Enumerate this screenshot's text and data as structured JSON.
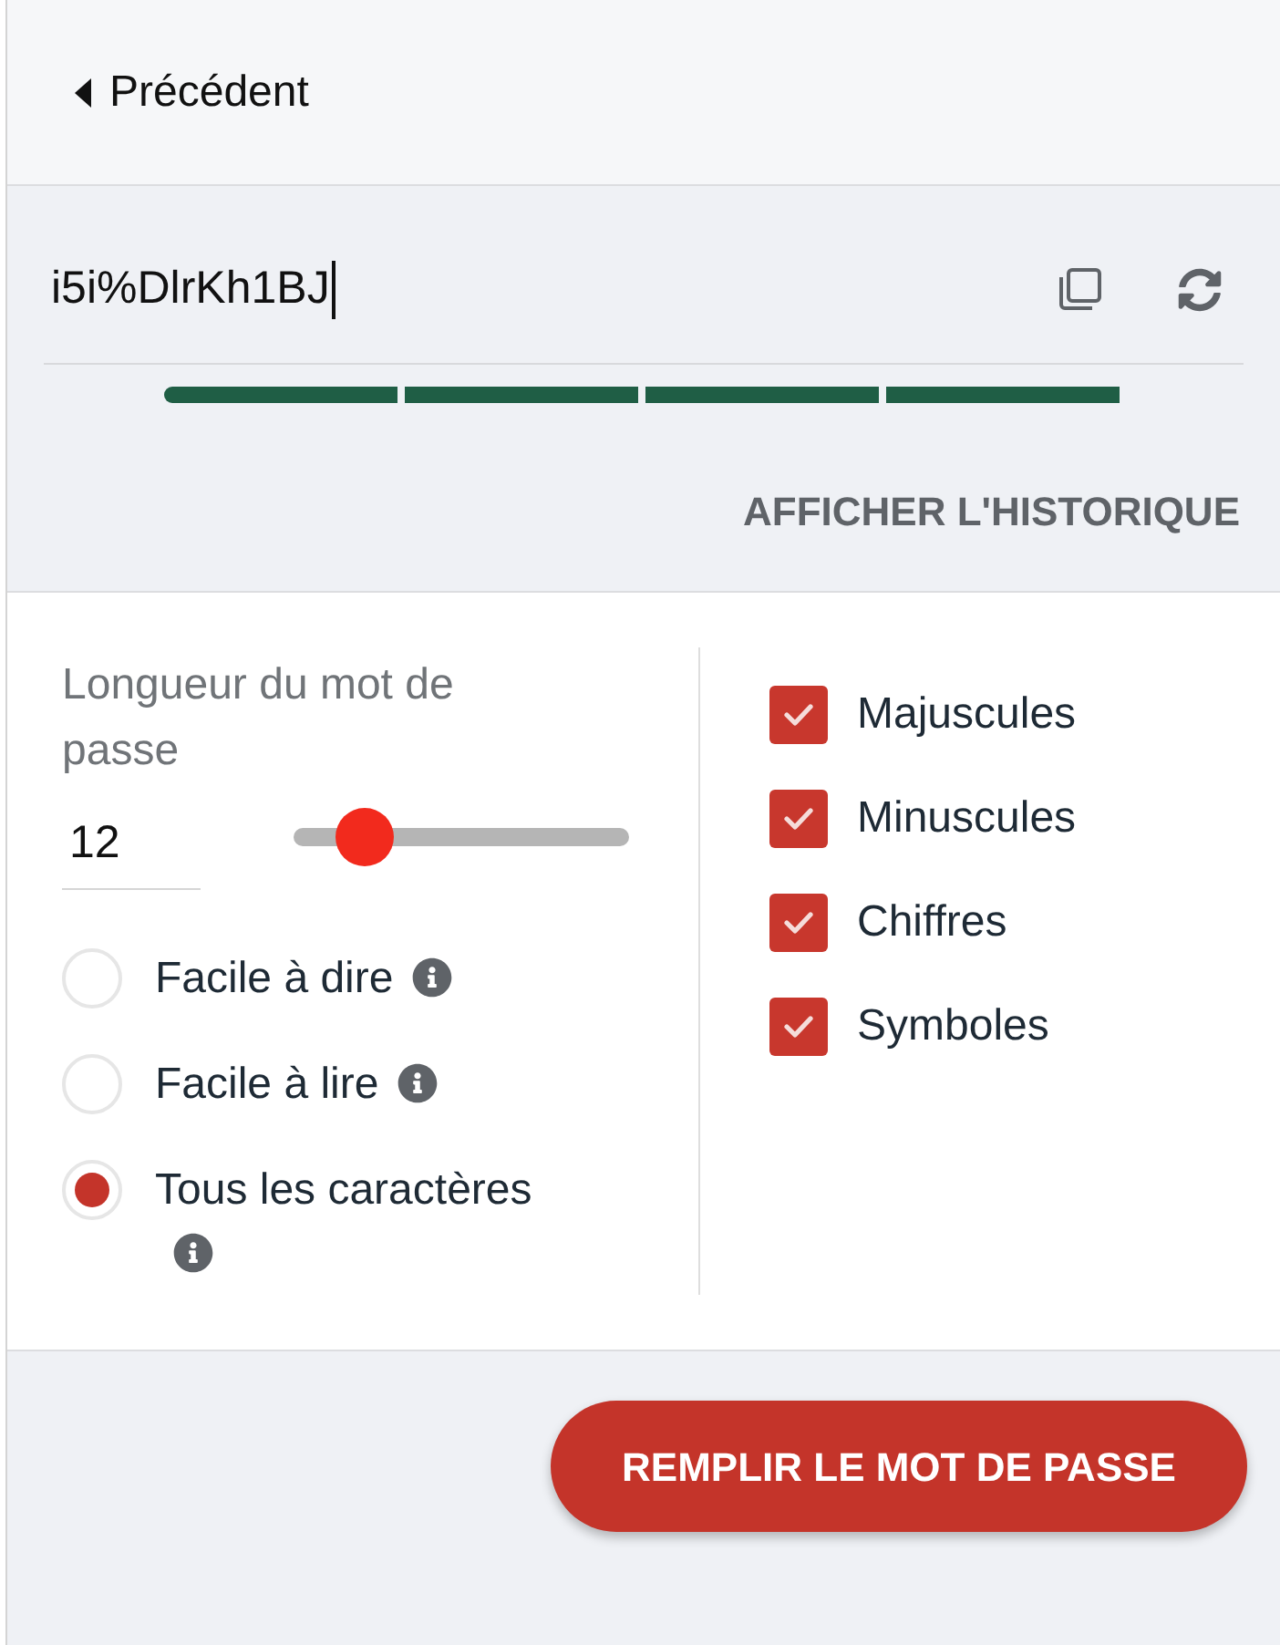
{
  "back_button": {
    "label": "Précédent"
  },
  "password": {
    "value": "i5i%DlrKh1BJ",
    "strength": {
      "level": 1
    }
  },
  "history_link": {
    "label": "AFFICHER L'HISTORIQUE"
  },
  "length": {
    "label": "Longueur du mot de passe",
    "value": "12",
    "level": 0.15
  },
  "modes": [
    {
      "label": "Facile à dire",
      "selected": false
    },
    {
      "label": "Facile à lire",
      "selected": false
    },
    {
      "label": "Tous les caractères",
      "selected": true
    }
  ],
  "character_sets": [
    {
      "label": "Majuscules",
      "checked": true
    },
    {
      "label": "Minuscules",
      "checked": true
    },
    {
      "label": "Chiffres",
      "checked": true
    },
    {
      "label": "Symboles",
      "checked": true
    }
  ],
  "fill_button": {
    "label": "REMPLIR LE MOT DE PASSE"
  }
}
